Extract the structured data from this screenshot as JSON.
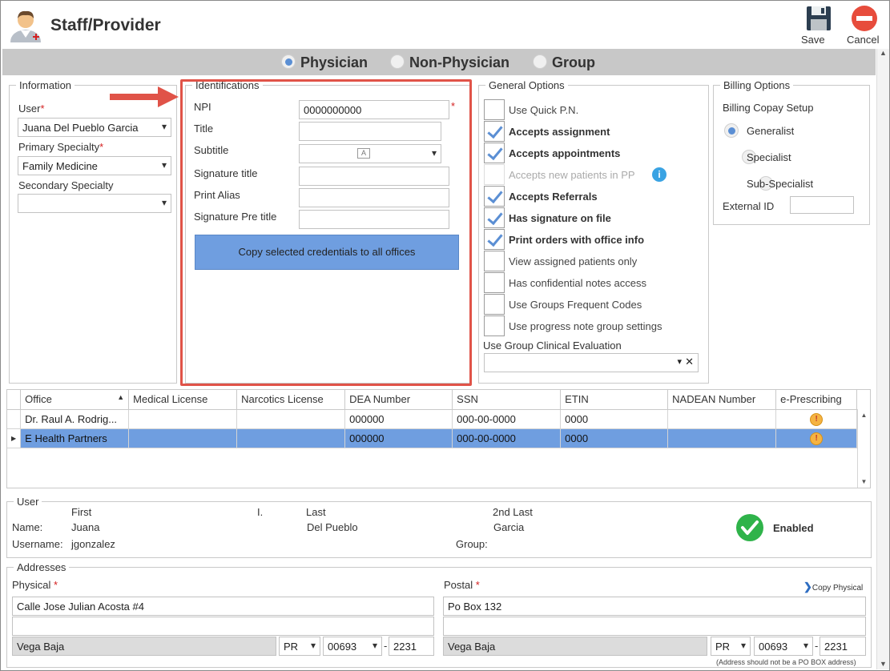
{
  "window": {
    "title": "Staff/Provider"
  },
  "toolbar": {
    "save_label": "Save",
    "cancel_label": "Cancel"
  },
  "tabs": [
    {
      "label": "Physician",
      "selected": true
    },
    {
      "label": "Non-Physician",
      "selected": false
    },
    {
      "label": "Group",
      "selected": false
    }
  ],
  "information": {
    "legend": "Information",
    "user_label": "User",
    "user_value": "Juana Del Pueblo Garcia",
    "primary_specialty_label": "Primary Specialty",
    "primary_specialty_value": "Family Medicine",
    "secondary_specialty_label": "Secondary Specialty",
    "secondary_specialty_value": ""
  },
  "identifications": {
    "legend": "Identifications",
    "npi_label": "NPI",
    "npi_value": "0000000000",
    "title_label": "Title",
    "subtitle_label": "Subtitle",
    "signature_title_label": "Signature title",
    "print_alias_label": "Print Alias",
    "signature_pre_title_label": "Signature Pre title",
    "copy_button": "Copy selected credentials to all offices"
  },
  "general_options": {
    "legend": "General Options",
    "items": [
      {
        "label": "Use Quick P.N.",
        "checked": false,
        "disabled": false
      },
      {
        "label": "Accepts assignment",
        "checked": true,
        "disabled": false
      },
      {
        "label": "Accepts appointments",
        "checked": true,
        "disabled": false
      },
      {
        "label": "Accepts new patients in PP",
        "checked": false,
        "disabled": true
      },
      {
        "label": "Accepts Referrals",
        "checked": true,
        "disabled": false
      },
      {
        "label": "Has signature on file",
        "checked": true,
        "disabled": false
      },
      {
        "label": "Print orders with office info",
        "checked": true,
        "disabled": false
      },
      {
        "label": "View assigned patients only",
        "checked": false,
        "disabled": false
      },
      {
        "label": "Has confidential notes access",
        "checked": false,
        "disabled": false
      },
      {
        "label": "Use Groups Frequent Codes",
        "checked": false,
        "disabled": false
      },
      {
        "label": "Use progress note group settings",
        "checked": false,
        "disabled": false
      }
    ],
    "clinical_eval_label": "Use Group Clinical Evaluation",
    "clinical_eval_value": ""
  },
  "billing": {
    "legend": "Billing Options",
    "copay_label": "Billing Copay Setup",
    "options": [
      {
        "label": "Generalist",
        "selected": true
      },
      {
        "label": "Specialist",
        "selected": false
      },
      {
        "label": "Sub-Specialist",
        "selected": false
      }
    ],
    "external_id_label": "External ID",
    "external_id_value": ""
  },
  "offices_table": {
    "columns": [
      "Office",
      "Medical License",
      "Narcotics License",
      "DEA Number",
      "SSN",
      "ETIN",
      "NADEAN Number",
      "e-Prescribing"
    ],
    "rows": [
      [
        "Dr. Raul A. Rodrig...",
        "",
        "",
        "000000",
        "000-00-0000",
        "0000",
        "",
        ""
      ],
      [
        "E Health Partners",
        "",
        "",
        "000000",
        "000-00-0000",
        "0000",
        "",
        ""
      ]
    ],
    "selected_row": 1
  },
  "user_section": {
    "legend": "User",
    "first_header": "First",
    "initial_header": "I.",
    "last_header": "Last",
    "second_last_header": "2nd Last",
    "name_label": "Name:",
    "first": "Juana",
    "last": "Del Pueblo",
    "second_last": "Garcia",
    "username_label": "Username:",
    "username": "jgonzalez",
    "group_label": "Group:",
    "status": "Enabled"
  },
  "addresses": {
    "legend": "Addresses",
    "copy_physical": "Copy Physical",
    "physical": {
      "label": "Physical",
      "line1": "Calle Jose Julian Acosta #4",
      "line2": "",
      "city": "Vega Baja",
      "state": "PR",
      "zip": "00693",
      "zip4": "2231"
    },
    "postal": {
      "label": "Postal",
      "line1": "Po Box 132",
      "line2": "",
      "city": "Vega Baja",
      "state": "PR",
      "zip": "00693",
      "zip4": "2231"
    },
    "note": "(Address should not be a PO BOX address)",
    "dash": "-"
  },
  "colors": {
    "accent": "#6f9ee0",
    "required": "#d42020",
    "callout": "#e05348",
    "enabled": "#2fb34a"
  }
}
